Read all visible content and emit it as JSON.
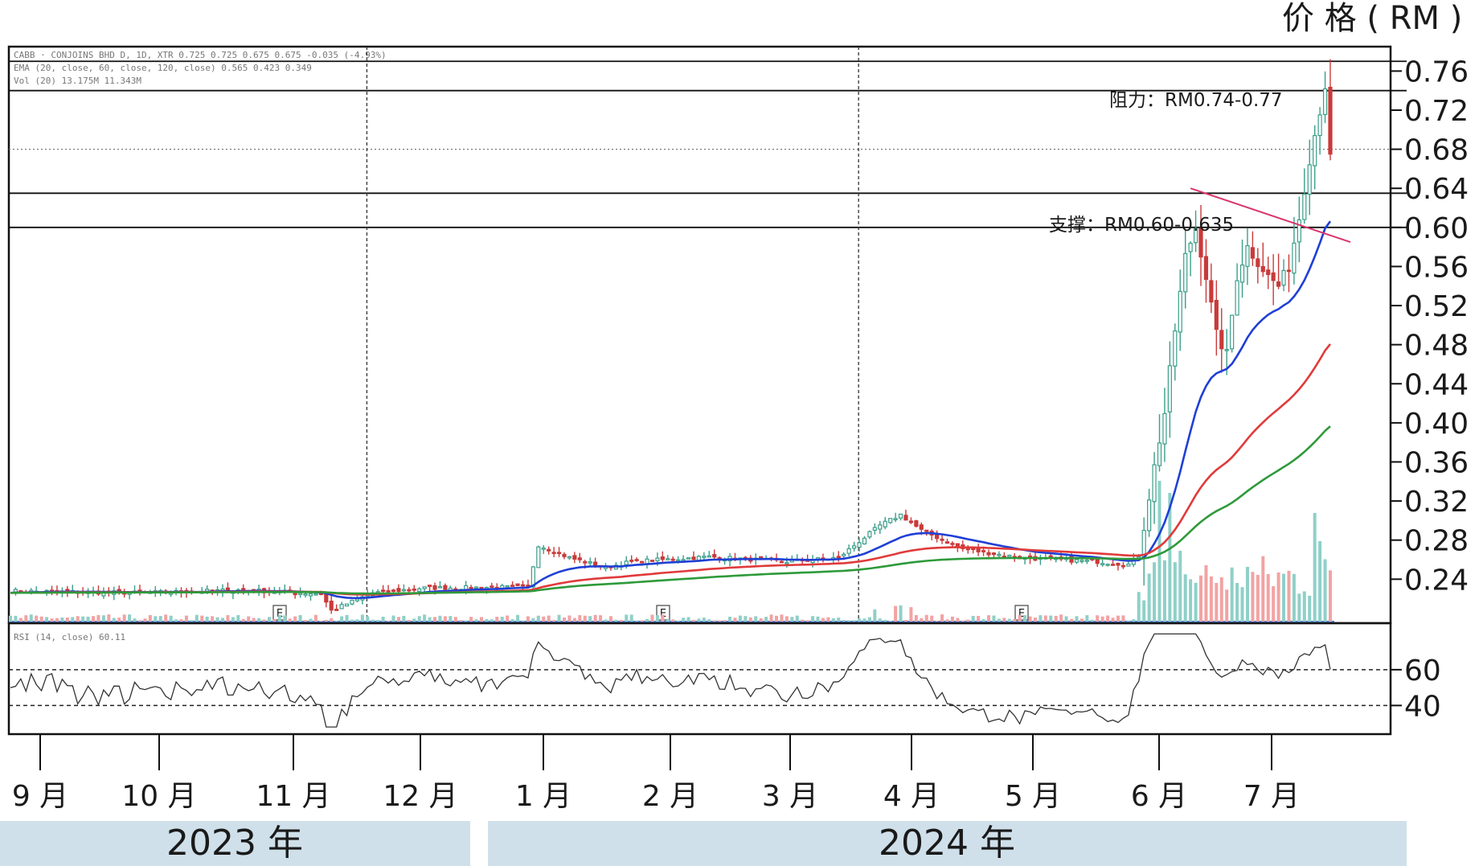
{
  "header": {
    "unit_label": "价 格 ( RM )",
    "legend_line1": "CABB · CONJOINS BHD D, 1D, XTR  0.725  0.725  0.675  0.675  -0.035 (-4.93%)",
    "legend_line2": "EMA (20, close, 60, close, 120, close)  0.565  0.423  0.349",
    "legend_line3": "Vol (20)  13.175M  11.343M",
    "rsi_legend": "RSI (14, close)  60.11"
  },
  "colors": {
    "up": "#3b9e8a",
    "down": "#c93a3a",
    "ema_fast": "#1f3fd6",
    "ema_mid": "#e03a3a",
    "ema_slow": "#2e9a3a",
    "vol_up": "#8fd0c8",
    "vol_down": "#f2a3a3",
    "trendline": "#d9366a",
    "year_band": "#cfe0ea"
  },
  "annotations": {
    "resistance": "阻力：RM0.74-0.77",
    "support": "支撑：RM0.60-0.635",
    "event_marker": "E"
  },
  "chart_data": {
    "type": "candlestick",
    "y_ticks": [
      "0.76",
      "0.72",
      "0.68",
      "0.64",
      "0.60",
      "0.56",
      "0.52",
      "0.48",
      "0.44",
      "0.40",
      "0.36",
      "0.32",
      "0.28",
      "0.24"
    ],
    "ylim": [
      0.195,
      0.785
    ],
    "rsi_ticks": [
      "60",
      "40"
    ],
    "rsi_range": [
      24,
      86
    ],
    "months": [
      "9 月",
      "10 月",
      "11 月",
      "12 月",
      "1 月",
      "2 月",
      "3 月",
      "4 月",
      "5 月",
      "6 月",
      "7 月"
    ],
    "years": [
      "2023 年",
      "2024 年"
    ],
    "resistance_levels": [
      0.74,
      0.77
    ],
    "support_levels": [
      0.6,
      0.635
    ],
    "reference_level": 0.68,
    "rsi_levels": [
      60,
      40
    ],
    "close_anchors": [
      [
        0,
        0.228
      ],
      [
        25,
        0.226
      ],
      [
        45,
        0.229
      ],
      [
        60,
        0.225
      ],
      [
        62,
        0.208
      ],
      [
        70,
        0.226
      ],
      [
        80,
        0.231
      ],
      [
        100,
        0.232
      ],
      [
        102,
        0.275
      ],
      [
        108,
        0.262
      ],
      [
        115,
        0.252
      ],
      [
        120,
        0.258
      ],
      [
        135,
        0.263
      ],
      [
        150,
        0.258
      ],
      [
        160,
        0.262
      ],
      [
        168,
        0.295
      ],
      [
        172,
        0.306
      ],
      [
        176,
        0.29
      ],
      [
        184,
        0.271
      ],
      [
        195,
        0.262
      ],
      [
        210,
        0.258
      ],
      [
        216,
        0.255
      ],
      [
        218,
        0.264
      ],
      [
        221,
        0.355
      ],
      [
        223,
        0.41
      ],
      [
        225,
        0.495
      ],
      [
        227,
        0.57
      ],
      [
        229,
        0.6
      ],
      [
        231,
        0.55
      ],
      [
        233,
        0.49
      ],
      [
        235,
        0.47
      ],
      [
        237,
        0.55
      ],
      [
        239,
        0.58
      ],
      [
        241,
        0.565
      ],
      [
        243,
        0.55
      ],
      [
        245,
        0.54
      ],
      [
        247,
        0.56
      ],
      [
        249,
        0.61
      ],
      [
        251,
        0.67
      ],
      [
        253,
        0.72
      ],
      [
        254,
        0.745
      ],
      [
        255,
        0.675
      ]
    ],
    "ema_periods": [
      20,
      60,
      120
    ],
    "bars": 256
  }
}
